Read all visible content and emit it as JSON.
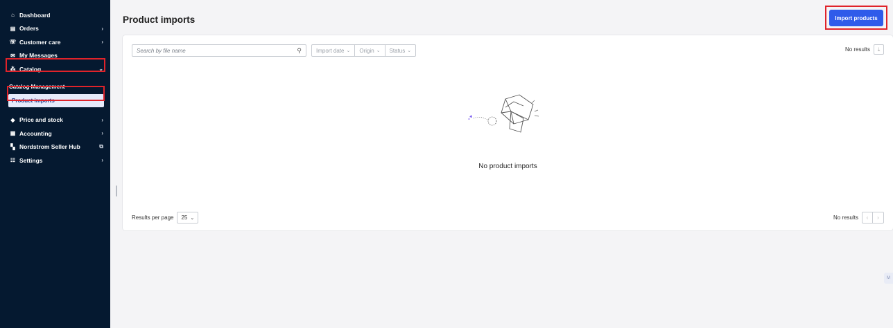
{
  "sidebar": {
    "items": [
      {
        "icon": "home-icon",
        "glyph": "⌂",
        "label": "Dashboard",
        "chevron": ""
      },
      {
        "icon": "orders-icon",
        "glyph": "▤",
        "label": "Orders",
        "chevron": "›"
      },
      {
        "icon": "customer-care-icon",
        "glyph": "☏",
        "label": "Customer care",
        "chevron": "›"
      },
      {
        "icon": "messages-icon",
        "glyph": "✉",
        "label": "My Messages",
        "chevron": ""
      },
      {
        "icon": "catalog-icon",
        "glyph": "⁂",
        "label": "Catalog",
        "chevron": "⌄"
      }
    ],
    "catalog_sub": {
      "header": "Catalog Management",
      "active": "Product imports"
    },
    "items_after": [
      {
        "icon": "tag-icon",
        "glyph": "◆",
        "label": "Price and stock",
        "chevron": "›"
      },
      {
        "icon": "accounting-icon",
        "glyph": "▦",
        "label": "Accounting",
        "chevron": "›"
      },
      {
        "icon": "hub-icon",
        "glyph": "▚",
        "label": "Nordstrom Seller Hub",
        "chevron": "⧉"
      },
      {
        "icon": "settings-icon",
        "glyph": "☷",
        "label": "Settings",
        "chevron": "›"
      }
    ]
  },
  "page": {
    "title": "Product imports",
    "import_button": "Import products"
  },
  "toolbar": {
    "search_placeholder": "Search by file name",
    "filters": [
      "Import date",
      "Origin",
      "Status"
    ],
    "results": "No results"
  },
  "empty_state": {
    "message": "No product imports"
  },
  "footer": {
    "results_per_page_label": "Results per page",
    "results_per_page_value": "25",
    "results": "No results",
    "prev": "‹",
    "next": "›"
  },
  "colors": {
    "sidebar_bg": "#051930",
    "primary": "#2f5bea",
    "highlight": "#e0232a"
  }
}
